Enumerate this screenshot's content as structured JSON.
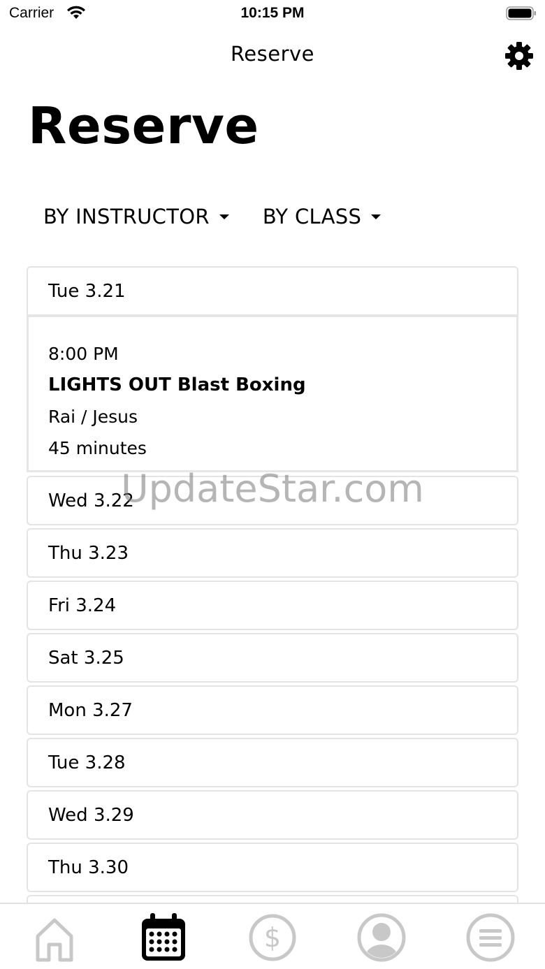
{
  "status_bar": {
    "carrier": "Carrier",
    "time": "10:15 PM",
    "icons": [
      "wifi-icon",
      "battery-icon"
    ]
  },
  "nav": {
    "title": "Reserve",
    "settings_icon": "gear-icon"
  },
  "page_title": "Reserve",
  "filters": [
    {
      "label": "BY INSTRUCTOR",
      "icon": "caret-down-icon"
    },
    {
      "label": "BY CLASS",
      "icon": "caret-down-icon"
    }
  ],
  "schedule": {
    "expanded_day": "Tue 3.21",
    "expanded_class": {
      "time": "8:00 PM",
      "name": "LIGHTS OUT Blast Boxing",
      "instructors": "Rai / Jesus",
      "duration": "45 minutes"
    },
    "days": [
      "Wed 3.22",
      "Thu 3.23",
      "Fri 3.24",
      "Sat 3.25",
      "Mon 3.27",
      "Tue 3.28",
      "Wed 3.29",
      "Thu 3.30"
    ]
  },
  "watermark": "UpdateStar.com",
  "tab_bar": {
    "tabs": [
      {
        "name": "home",
        "icon": "home-icon",
        "active": false
      },
      {
        "name": "reserve",
        "icon": "calendar-icon",
        "active": true
      },
      {
        "name": "pricing",
        "icon": "dollar-icon",
        "active": false
      },
      {
        "name": "profile",
        "icon": "person-icon",
        "active": false
      },
      {
        "name": "menu",
        "icon": "menu-icon",
        "active": false
      }
    ],
    "active_color": "#000000",
    "inactive_color": "#c8c8c8"
  }
}
